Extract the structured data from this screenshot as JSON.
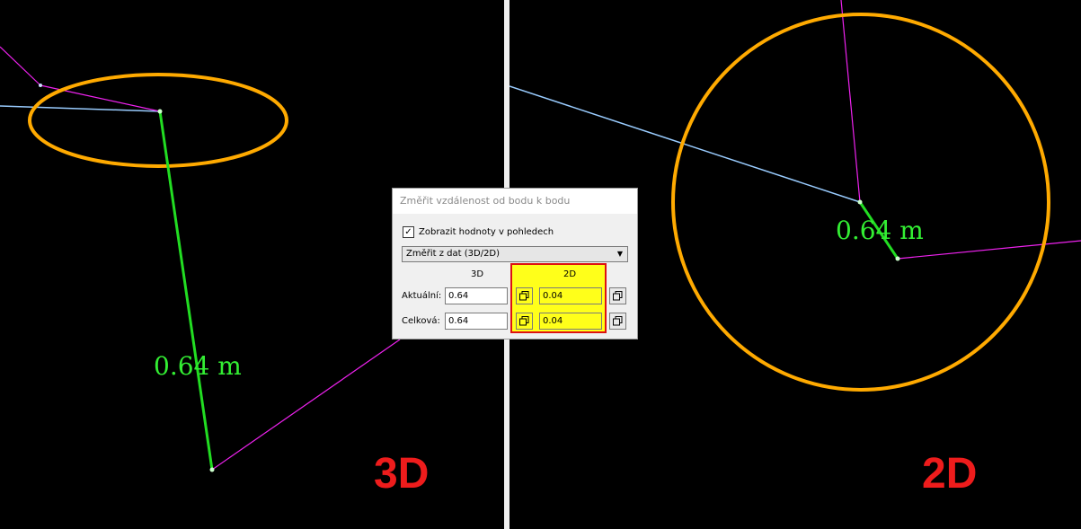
{
  "views": {
    "left": {
      "tag": "3D",
      "measurement_label": "0.64 m"
    },
    "right": {
      "tag": "2D",
      "measurement_label": "0.64 m"
    }
  },
  "dialog": {
    "title": "Změřit vzdálenost od bodu k bodu",
    "show_values_checkbox": {
      "label": "Zobrazit hodnoty v pohledech",
      "checked": true
    },
    "mode_select": {
      "value": "Změřit z dat (3D/2D)"
    },
    "columns": {
      "col_3d": "3D",
      "col_2d": "2D"
    },
    "rows": {
      "current": {
        "label": "Aktuální:",
        "value_3d": "0.64",
        "value_2d": "0.04"
      },
      "total": {
        "label": "Celková:",
        "value_3d": "0.64",
        "value_2d": "0.04"
      }
    }
  },
  "colors": {
    "measure_line": "#22dd22",
    "circle": "#ffaa00",
    "polyline_magenta": "#ee22ee",
    "polyline_blue": "#99ccff",
    "tag_red": "#ee1c1c",
    "highlight_yellow": "#ffff1a"
  }
}
